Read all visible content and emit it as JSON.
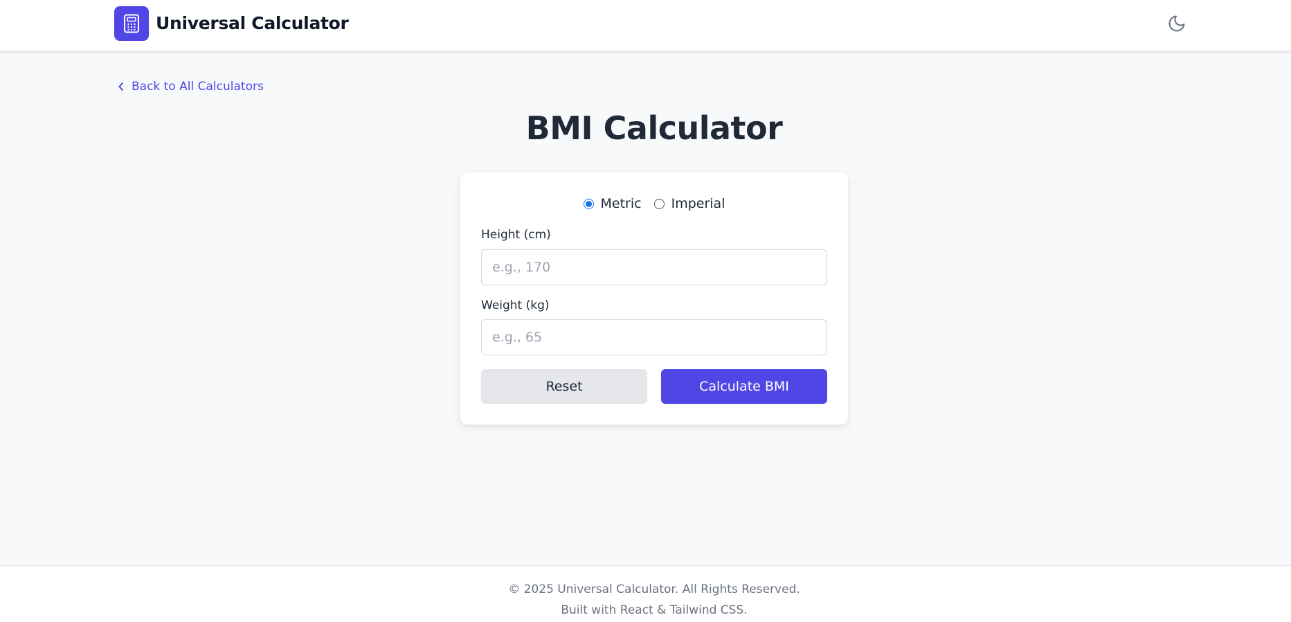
{
  "header": {
    "app_title": "Universal Calculator",
    "logo_icon": "calculator-icon",
    "theme_icon": "moon-icon",
    "brand_color": "#4f46e5"
  },
  "nav": {
    "back_label": "Back to All Calculators",
    "back_icon": "chevron-left-icon"
  },
  "page": {
    "title": "BMI Calculator"
  },
  "form": {
    "units": [
      {
        "label": "Metric",
        "selected": true
      },
      {
        "label": "Imperial",
        "selected": false
      }
    ],
    "height": {
      "label": "Height (cm)",
      "placeholder": "e.g., 170",
      "value": ""
    },
    "weight": {
      "label": "Weight (kg)",
      "placeholder": "e.g., 65",
      "value": ""
    },
    "reset_label": "Reset",
    "calculate_label": "Calculate BMI"
  },
  "footer": {
    "copyright": "© 2025 Universal Calculator. All Rights Reserved.",
    "built_with": "Built with React & Tailwind CSS."
  }
}
